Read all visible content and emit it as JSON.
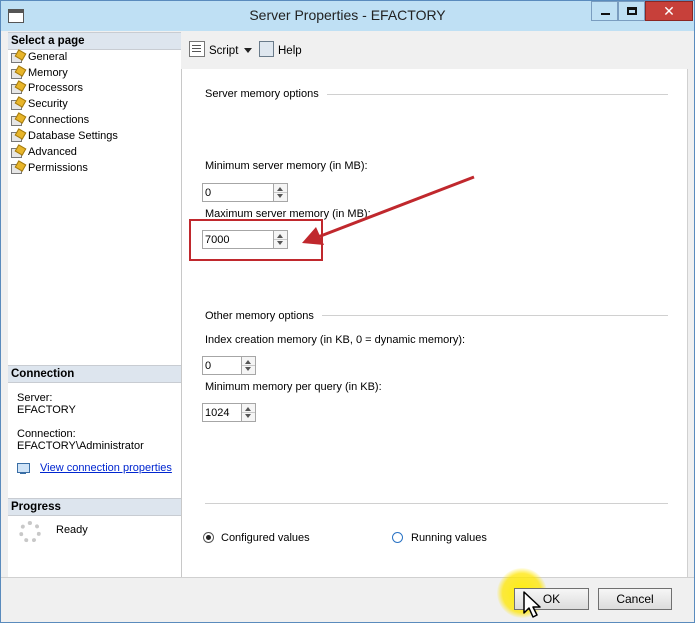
{
  "window": {
    "title": "Server Properties - EFACTORY",
    "close_glyph": "✕"
  },
  "left_pane": {
    "select_page_header": "Select a page",
    "pages": [
      {
        "label": "General",
        "icon": "page-wrench-icon"
      },
      {
        "label": "Memory",
        "icon": "page-wrench-icon"
      },
      {
        "label": "Processors",
        "icon": "page-wrench-icon"
      },
      {
        "label": "Security",
        "icon": "page-wrench-icon"
      },
      {
        "label": "Connections",
        "icon": "page-wrench-icon"
      },
      {
        "label": "Database Settings",
        "icon": "page-wrench-icon"
      },
      {
        "label": "Advanced",
        "icon": "page-wrench-icon"
      },
      {
        "label": "Permissions",
        "icon": "page-wrench-icon"
      }
    ],
    "connection_header": "Connection",
    "server_label": "Server:",
    "server_value": "EFACTORY",
    "connection_label": "Connection:",
    "connection_value": "EFACTORY\\Administrator",
    "view_link": "View connection properties",
    "progress_header": "Progress",
    "progress_status": "Ready"
  },
  "toolbar": {
    "script_label": "Script",
    "help_label": "Help"
  },
  "server_memory": {
    "group_title": "Server memory options",
    "min_label": "Minimum server memory (in MB):",
    "min_value": "0",
    "max_label": "Maximum server memory (in MB):",
    "max_value": "7000"
  },
  "other_memory": {
    "group_title": "Other memory options",
    "index_label": "Index creation memory (in KB, 0 = dynamic memory):",
    "index_value": "0",
    "query_label": "Minimum memory per query (in KB):",
    "query_value": "1024"
  },
  "value_mode": {
    "configured_label": "Configured values",
    "running_label": "Running values",
    "selected": "configured"
  },
  "buttons": {
    "ok_label": "OK",
    "cancel_label": "Cancel"
  },
  "colors": {
    "annotation_red": "#c0282d",
    "cursor_highlight": "#ffe600",
    "link_blue": "#0026d0"
  }
}
